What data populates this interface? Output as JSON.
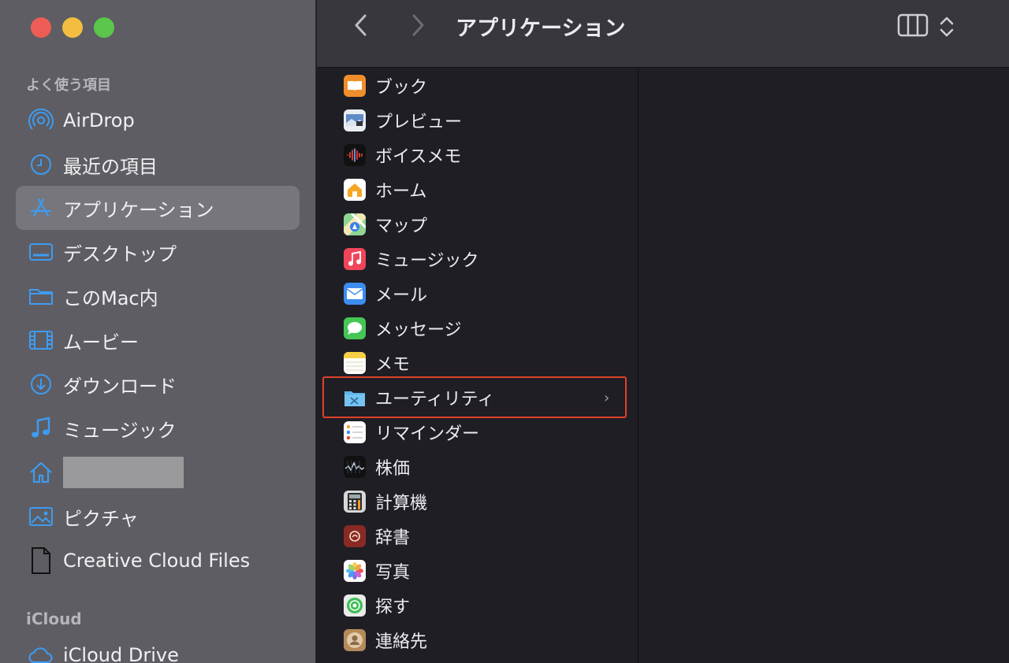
{
  "sidebar": {
    "favorites_title": "よく使う項目",
    "items": [
      {
        "label": "AirDrop",
        "icon": "airdrop-icon"
      },
      {
        "label": "最近の項目",
        "icon": "clock-icon"
      },
      {
        "label": "アプリケーション",
        "icon": "applications-icon",
        "selected": true
      },
      {
        "label": "デスクトップ",
        "icon": "desktop-icon"
      },
      {
        "label": "このMac内",
        "icon": "folder-icon"
      },
      {
        "label": "ムービー",
        "icon": "film-icon"
      },
      {
        "label": "ダウンロード",
        "icon": "download-icon"
      },
      {
        "label": "ミュージック",
        "icon": "music-note-icon"
      },
      {
        "label": "",
        "icon": "home-icon",
        "redacted": true
      },
      {
        "label": "ピクチャ",
        "icon": "photo-icon"
      },
      {
        "label": "Creative Cloud Files",
        "icon": "document-icon"
      }
    ],
    "icloud_title": "iCloud",
    "icloud_items": [
      {
        "label": "iCloud Drive",
        "icon": "cloud-icon"
      }
    ]
  },
  "toolbar": {
    "title": "アプリケーション",
    "back_icon": "chevron-left-icon",
    "forward_icon": "chevron-right-icon",
    "view_icon": "column-view-icon",
    "sort_icon": "up-down-chevron-icon"
  },
  "apps": [
    {
      "label": "ブック",
      "icon": "books-app-icon"
    },
    {
      "label": "プレビュー",
      "icon": "preview-app-icon"
    },
    {
      "label": "ボイスメモ",
      "icon": "voice-memos-app-icon"
    },
    {
      "label": "ホーム",
      "icon": "home-app-icon"
    },
    {
      "label": "マップ",
      "icon": "maps-app-icon"
    },
    {
      "label": "ミュージック",
      "icon": "music-app-icon"
    },
    {
      "label": "メール",
      "icon": "mail-app-icon"
    },
    {
      "label": "メッセージ",
      "icon": "messages-app-icon"
    },
    {
      "label": "メモ",
      "icon": "notes-app-icon"
    },
    {
      "label": "ユーティリティ",
      "icon": "utilities-folder-icon",
      "folder": true
    },
    {
      "label": "リマインダー",
      "icon": "reminders-app-icon"
    },
    {
      "label": "株価",
      "icon": "stocks-app-icon"
    },
    {
      "label": "計算機",
      "icon": "calculator-app-icon"
    },
    {
      "label": "辞書",
      "icon": "dictionary-app-icon"
    },
    {
      "label": "写真",
      "icon": "photos-app-icon"
    },
    {
      "label": "探す",
      "icon": "find-my-app-icon"
    },
    {
      "label": "連絡先",
      "icon": "contacts-app-icon"
    }
  ],
  "folder_chevron": "›",
  "colors": {
    "sidebar_bg": "#5e5d63",
    "selection_bg": "#77767c",
    "accent_blue": "#3d9cf2",
    "highlight_red": "#e0402b"
  }
}
